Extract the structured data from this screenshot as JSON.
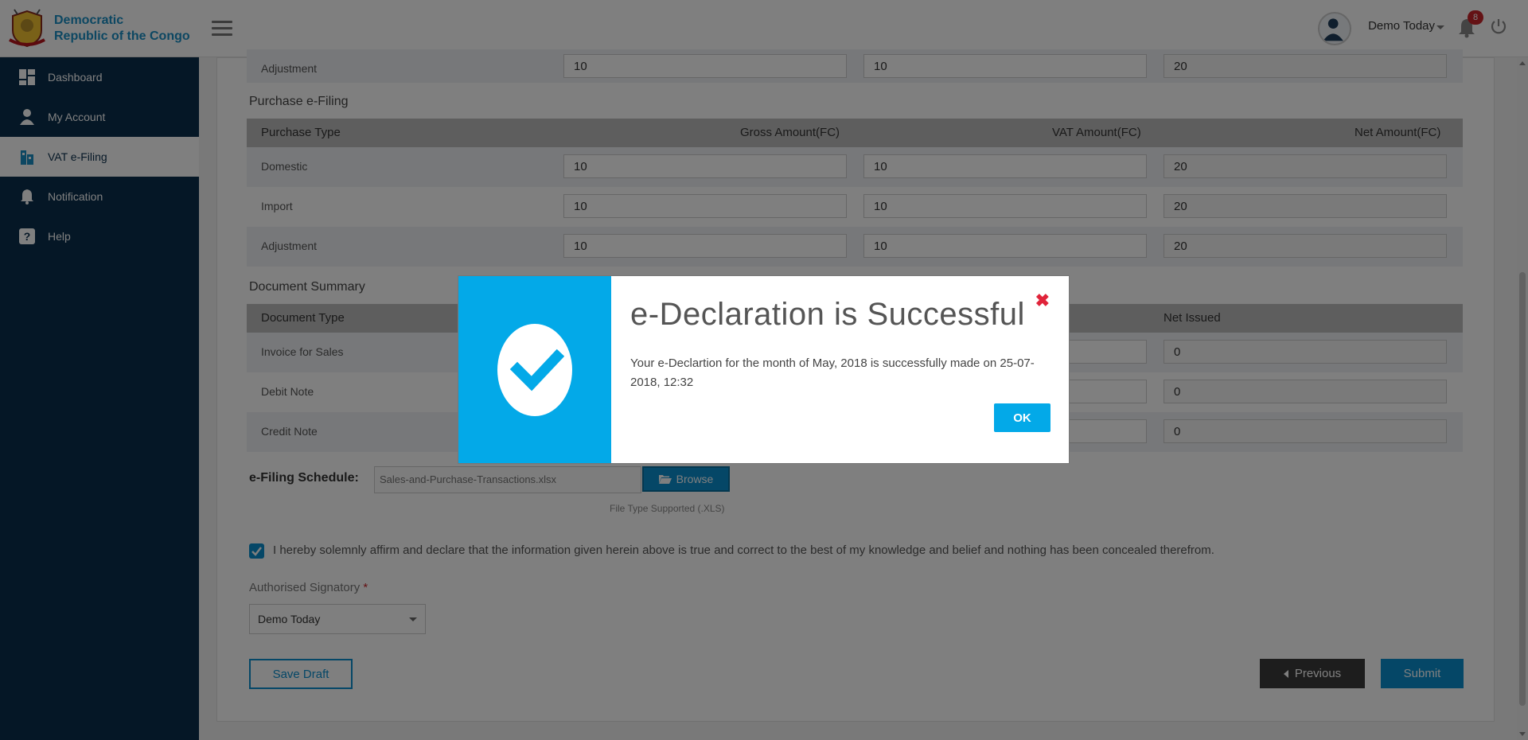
{
  "header": {
    "logo_text_1": "Democratic",
    "logo_text_2": "Republic of the Congo",
    "user_name": "Demo Today",
    "notification_count": "8"
  },
  "sidebar": {
    "items": [
      {
        "label": "Dashboard",
        "icon": "dashboard-icon"
      },
      {
        "label": "My Account",
        "icon": "user-icon"
      },
      {
        "label": "VAT e-Filing",
        "icon": "building-icon",
        "active": true
      },
      {
        "label": "Notification",
        "icon": "bell-icon"
      },
      {
        "label": "Help",
        "icon": "help-icon"
      }
    ]
  },
  "sales_top_row": {
    "label": "Adjustment",
    "gross": "10",
    "vat": "10",
    "net": "20"
  },
  "purchase": {
    "title": "Purchase e-Filing",
    "headers": {
      "type": "Purchase Type",
      "gross": "Gross Amount(FC)",
      "vat": "VAT Amount(FC)",
      "net": "Net Amount(FC)"
    },
    "rows": [
      {
        "label": "Domestic",
        "gross": "10",
        "vat": "10",
        "net": "20"
      },
      {
        "label": "Import",
        "gross": "10",
        "vat": "10",
        "net": "20"
      },
      {
        "label": "Adjustment",
        "gross": "10",
        "vat": "10",
        "net": "20"
      }
    ]
  },
  "documents": {
    "title": "Document Summary",
    "headers": {
      "type": "Document Type",
      "net": "Net Issued"
    },
    "rows": [
      {
        "label": "Invoice for Sales",
        "net": "0"
      },
      {
        "label": "Debit Note",
        "net": "0"
      },
      {
        "label": "Credit Note",
        "net": "0"
      }
    ]
  },
  "schedule": {
    "label": "e-Filing Schedule:",
    "file_name": "Sales-and-Purchase-Transactions.xlsx",
    "browse_label": "Browse",
    "file_type_note": "File Type Supported (.XLS)"
  },
  "declaration": {
    "text": "I hereby solemnly affirm and declare that the information given herein above is true and correct to the best of my knowledge and belief and nothing has been concealed therefrom.",
    "checked": true
  },
  "signatory": {
    "label": "Authorised Signatory",
    "required_mark": "*",
    "selected": "Demo Today"
  },
  "actions": {
    "save_draft": "Save Draft",
    "previous": "Previous",
    "submit": "Submit"
  },
  "modal": {
    "title": "e-Declaration is Successful",
    "message": "Your e-Declartion for the month of May, 2018 is successfully made on 25-07-2018, 12:32",
    "close_glyph": "✖",
    "ok_label": "OK",
    "accent": "#03a9e8"
  }
}
